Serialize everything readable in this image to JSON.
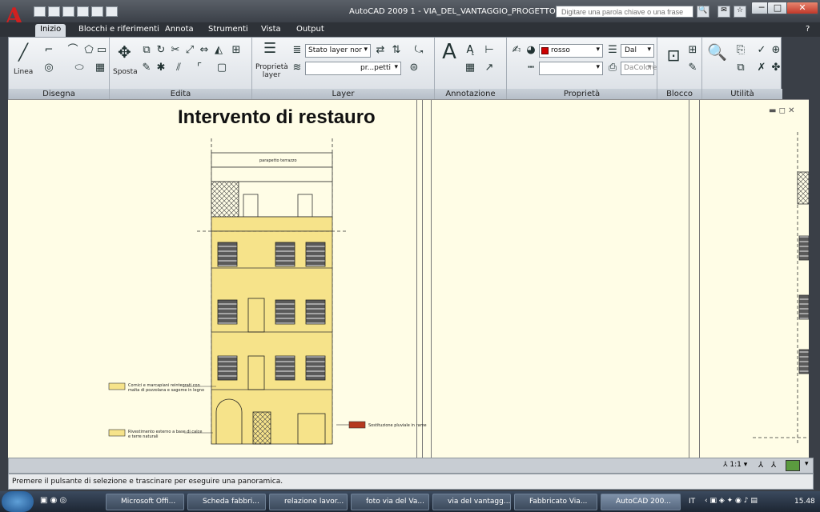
{
  "window": {
    "title": "AutoCAD 2009 1 - VIA_DEL_VANTAGGIO_PROGETTO.dwg"
  },
  "search": {
    "placeholder": "Digitare una parola chiave o una frase"
  },
  "ribbon_tabs": [
    "Inizio",
    "Blocchi e riferimenti",
    "Annota",
    "Strumenti",
    "Vista",
    "Output"
  ],
  "panels": {
    "disegna": "Disegna",
    "edita": "Edita",
    "layer": "Layer",
    "annotazione": "Annotazione",
    "proprieta": "Proprietà",
    "blocco": "Blocco",
    "utilita": "Utilità"
  },
  "tools": {
    "linea": "Linea",
    "sposta": "Sposta",
    "proprieta_layer": "Proprietà layer"
  },
  "layer": {
    "state": "Stato layer nor",
    "current": "pr...petti"
  },
  "properties": {
    "color": "rosso",
    "linetype": "Dal",
    "lineweight": "DaColore"
  },
  "colors": {
    "layer_color": "#cc0000",
    "facade": "#f6e38a",
    "annotation_box": "#b5391f"
  },
  "drawing": {
    "title": "Intervento di restauro",
    "labels": {
      "terrace": "parapetto terrazzo",
      "cornice": "Cornici e marcapiani reintegrati con malta di pozzolana e sagome in legno",
      "rivestimento": "Rivestimento esterno a base di calce e terre naturali",
      "sostituzione": "Sostituzione pluviale in rame"
    }
  },
  "status": {
    "scale": "1:1"
  },
  "command_line": "Premere il pulsante di selezione e trascinare per eseguire una panoramica.",
  "taskbar": {
    "items": [
      "Microsoft Offi...",
      "Scheda fabbri...",
      "relazione lavor...",
      "foto via del Va...",
      "via del vantagg...",
      "Fabbricato Via...",
      "AutoCAD 200..."
    ],
    "language": "IT",
    "clock": "15.48"
  }
}
